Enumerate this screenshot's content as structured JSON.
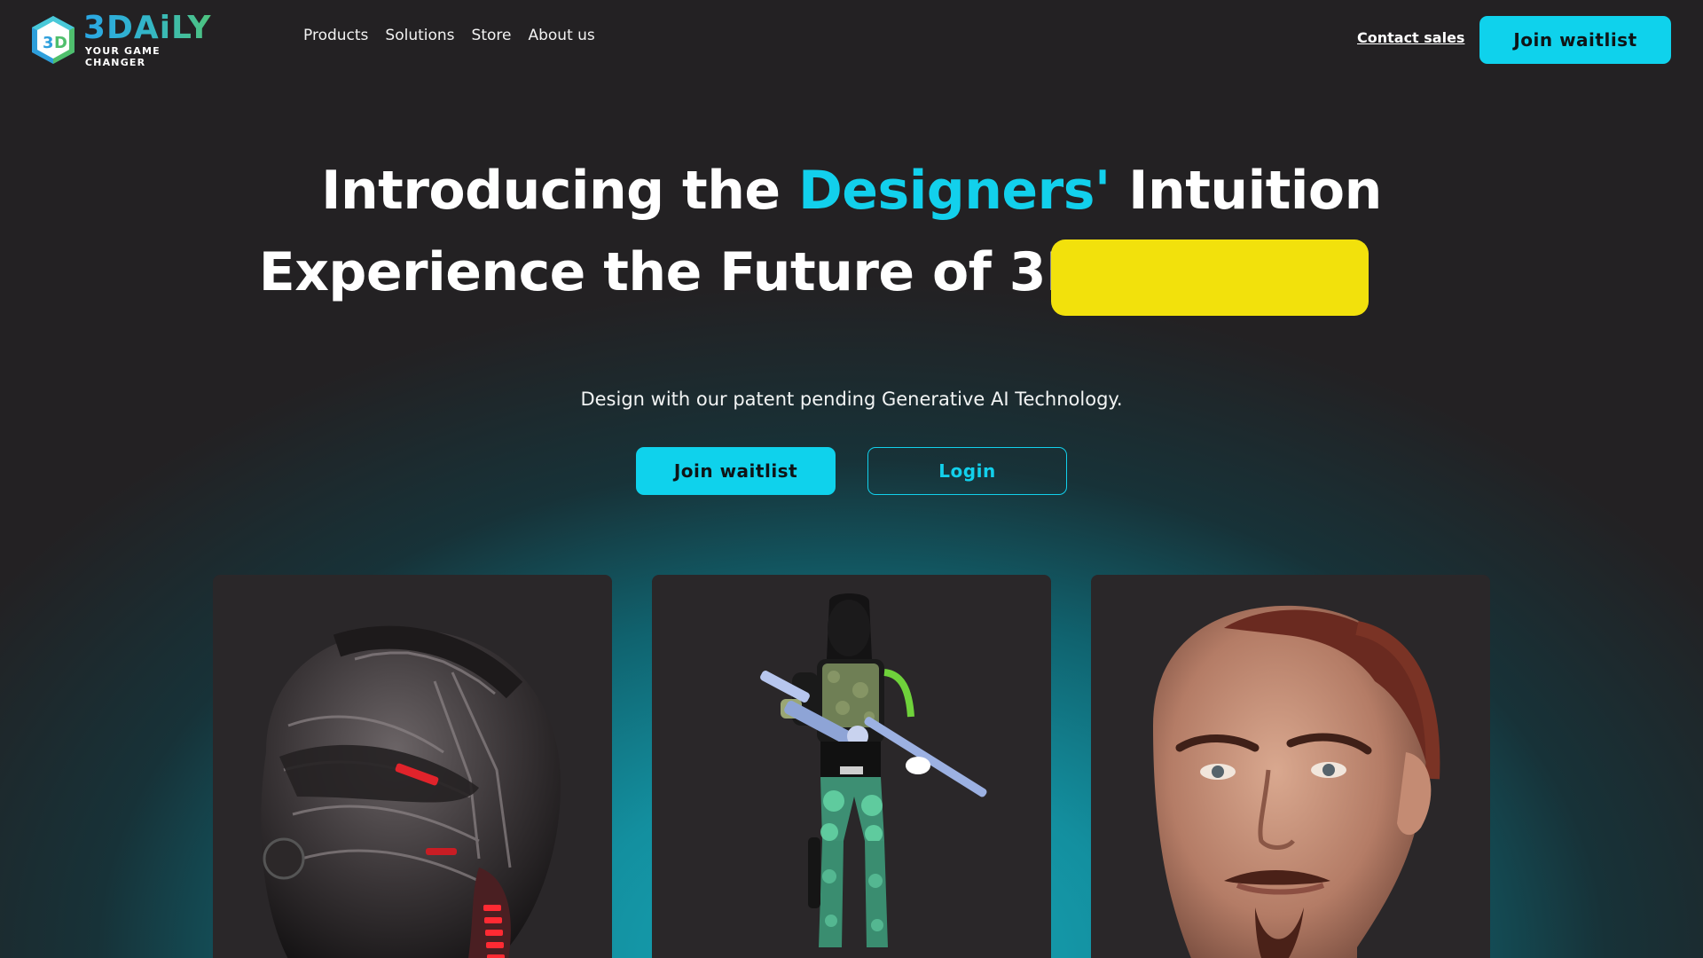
{
  "brand": {
    "name": "3DAiLY",
    "tagline": "YOUR GAME CHANGER"
  },
  "nav": {
    "items": [
      {
        "label": "Products"
      },
      {
        "label": "Solutions"
      },
      {
        "label": "Store"
      },
      {
        "label": "About us"
      }
    ],
    "contact_label": "Contact sales",
    "cta_label": "Join waitlist"
  },
  "hero": {
    "line1_prefix": "Introducing the ",
    "line1_accent": "Designers'",
    "line1_suffix": " Intuition",
    "line2": "Experience the Future of 3D",
    "subtitle": "Design with our patent pending Generative AI Technology.",
    "join_label": "Join waitlist",
    "login_label": "Login"
  },
  "cards": [
    {
      "subject": "sci-fi-helmet"
    },
    {
      "subject": "soldier-with-rifle"
    },
    {
      "subject": "man-head"
    }
  ],
  "colors": {
    "accent": "#0fd2ec",
    "highlight": "#f2e10c",
    "background": "#232123",
    "card": "#2a2729"
  }
}
